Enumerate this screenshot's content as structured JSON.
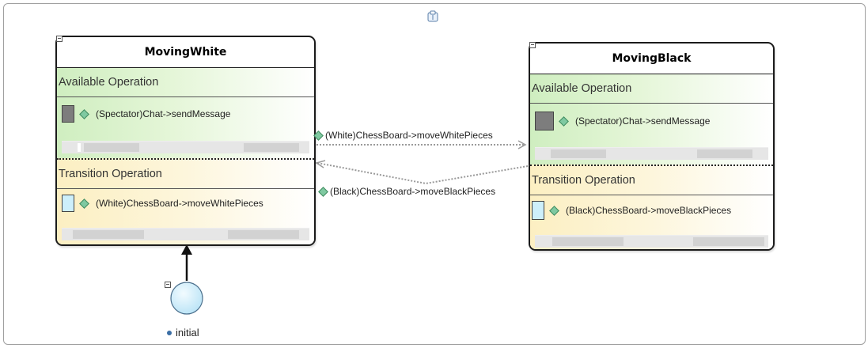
{
  "diagram": {
    "icons": {
      "top_center": "layout-icon"
    },
    "states": [
      {
        "id": "moving-white",
        "title": "MovingWhite",
        "available_label": "Available Operation",
        "available_ops": [
          {
            "text": "(Spectator)Chat->sendMessage",
            "box": "gray"
          }
        ],
        "transition_label": "Transition Operation",
        "transition_ops": [
          {
            "text": "(White)ChessBoard->moveWhitePieces",
            "box": "light"
          }
        ]
      },
      {
        "id": "moving-black",
        "title": "MovingBlack",
        "available_label": "Available Operation",
        "available_ops": [
          {
            "text": "(Spectator)Chat->sendMessage",
            "box": "gray"
          }
        ],
        "transition_label": "Transition Operation",
        "transition_ops": [
          {
            "text": "(Black)ChessBoard->moveBlackPieces",
            "box": "light"
          }
        ]
      }
    ],
    "edges": [
      {
        "from": "MovingWhite",
        "to": "MovingBlack",
        "label": "(White)ChessBoard->moveWhitePieces"
      },
      {
        "from": "MovingBlack",
        "to": "MovingWhite",
        "label": "(Black)ChessBoard->moveBlackPieces"
      }
    ],
    "initial": {
      "label": "initial"
    }
  }
}
